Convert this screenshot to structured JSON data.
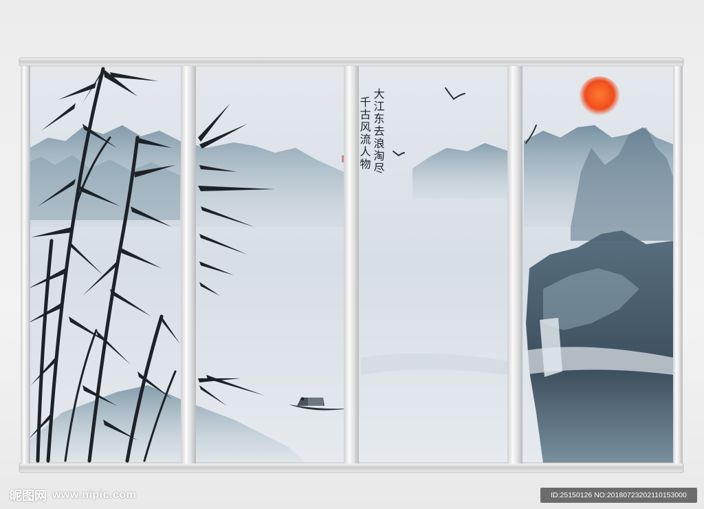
{
  "artwork": {
    "calligraphy_lines": [
      "大江东去浪淘尽",
      "千古风流人物"
    ],
    "sun_color": "#ef4d1e",
    "ink_color": "#1c2227",
    "mist_color": "#dde3e8",
    "mountain_color": "#5f7f92",
    "frame_color": "#d9dadb"
  },
  "watermark": {
    "logo_text": "昵图网",
    "site": "www.nipic.com",
    "id_label": "ID:25150126 NO:20180723202110153000"
  }
}
